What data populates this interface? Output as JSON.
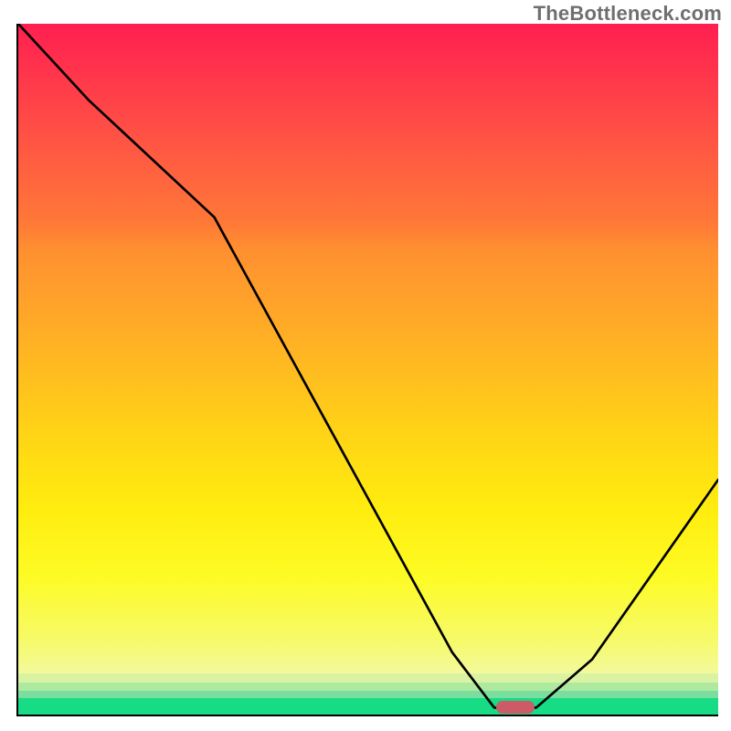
{
  "watermark": "TheBottleneck.com",
  "chart_data": {
    "type": "line",
    "title": "",
    "xlabel": "",
    "ylabel": "",
    "xlim": [
      0,
      100
    ],
    "ylim": [
      0,
      100
    ],
    "x": [
      0,
      10,
      28,
      62,
      68,
      74,
      82,
      100
    ],
    "y": [
      100,
      89,
      72,
      9,
      1,
      1,
      8,
      34
    ],
    "marker": {
      "x": 71,
      "y": 1
    },
    "background_gradient": {
      "top_color": "#ff1f50",
      "mid_color": "#ffed0f",
      "bottom_color": "#17db85"
    }
  }
}
